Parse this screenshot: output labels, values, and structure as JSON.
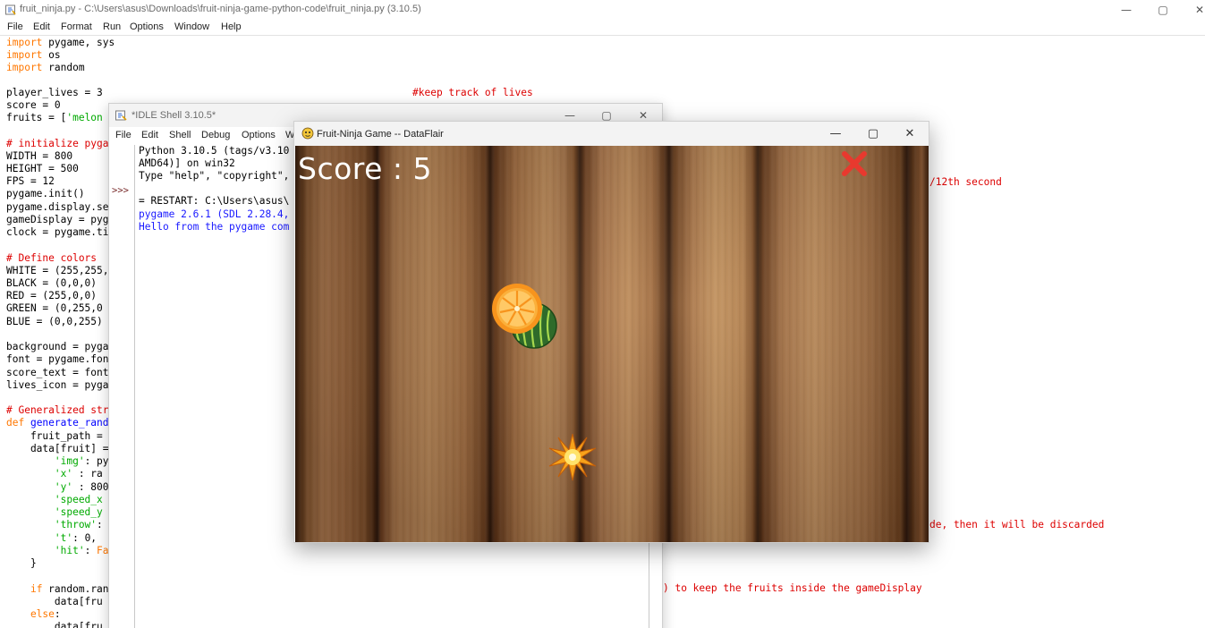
{
  "editor": {
    "title": "fruit_ninja.py - C:\\Users\\asus\\Downloads\\fruit-ninja-game-python-code\\fruit_ninja.py (3.10.5)",
    "menu": [
      "File",
      "Edit",
      "Format",
      "Run",
      "Options",
      "Window",
      "Help"
    ],
    "window_buttons": {
      "minimize": "—",
      "maximize": "▢",
      "close": "✕"
    },
    "code": {
      "l1_kw": "import",
      "l1_rest": " pygame, sys",
      "l2_kw": "import",
      "l2_rest": " os",
      "l3_kw": "import",
      "l3_rest": " random",
      "l5": "player_lives = 3",
      "l6": "score = 0",
      "l7_a": "fruits = [",
      "l7_str": "'melon",
      "l9_cm": "# initialize pyga",
      "l10": "WIDTH = 800",
      "l11": "HEIGHT = 500",
      "l12": "FPS = 12",
      "l13": "pygame.init()",
      "l14": "pygame.display.se",
      "l15": "gameDisplay = pyg",
      "l16": "clock = pygame.ti",
      "l18_cm": "# Define colors",
      "l19": "WHITE = (255,255,",
      "l20": "BLACK = (0,0,0)",
      "l21": "RED = (255,0,0)",
      "l22": "GREEN = (0,255,0",
      "l23": "BLUE = (0,0,255)",
      "l25": "background = pyga",
      "l26": "font = pygame.fon",
      "l27": "score_text = font",
      "l28": "lives_icon = pyga",
      "l30_cm": "# Generalized str",
      "l31_kw": "def",
      "l31_df": " generate_rand",
      "l32": "    fruit_path =",
      "l33": "    data[fruit] =",
      "l34_str": "        'img'",
      "l34_rest": ": py",
      "l35_str": "        'x'",
      "l35_rest": " : ra",
      "l36_str": "        'y'",
      "l36_rest": " : 800",
      "l37_str": "        'speed_x",
      "l38_str": "        'speed_y",
      "l39_str": "        'throw'",
      "l39_rest": ":",
      "l40_str": "        't'",
      "l40_rest": ": 0,",
      "l41_str": "        'hit'",
      "l41_rest": ": ",
      "l41_kw": "Fa",
      "l42": "    }",
      "l44_a": "    ",
      "l44_kw": "if",
      "l44_rest": " random.ran",
      "l45": "        data[fru",
      "l46_a": "    ",
      "l46_kw": "else",
      "l46_rest": ":",
      "l47": "        data[fru"
    },
    "right_comments": {
      "c1": "#keep track of lives",
      "c2": "/12th second",
      "c3": "de, then it will be discarded",
      "c4": ") to keep the fruits inside the gameDisplay"
    }
  },
  "shell": {
    "title": "*IDLE Shell 3.10.5*",
    "menu": [
      "File",
      "Edit",
      "Shell",
      "Debug",
      "Options",
      "W"
    ],
    "window_buttons": {
      "minimize": "—",
      "maximize": "▢",
      "close": "✕"
    },
    "prompt": ">>>",
    "lines": {
      "s1": "Python 3.10.5 (tags/v3.10",
      "s2": "AMD64)] on win32",
      "s3": "Type \"help\", \"copyright\",",
      "s5": "= RESTART: C:\\Users\\asus\\",
      "s6": "pygame 2.6.1 (SDL 2.28.4,",
      "s7": "Hello from the pygame com"
    }
  },
  "game": {
    "title": "Fruit-Ninja Game -- DataFlair",
    "window_buttons": {
      "minimize": "—",
      "maximize": "▢",
      "close": "✕"
    },
    "score_text": "Score : 5",
    "lives_icon": "red-x-icon",
    "objects": [
      "orange",
      "watermelon",
      "bomb-explosion"
    ],
    "colors": {
      "lives_x": "#e8392e",
      "orange": "#f7941d",
      "melon": "#2f6b2a"
    }
  }
}
